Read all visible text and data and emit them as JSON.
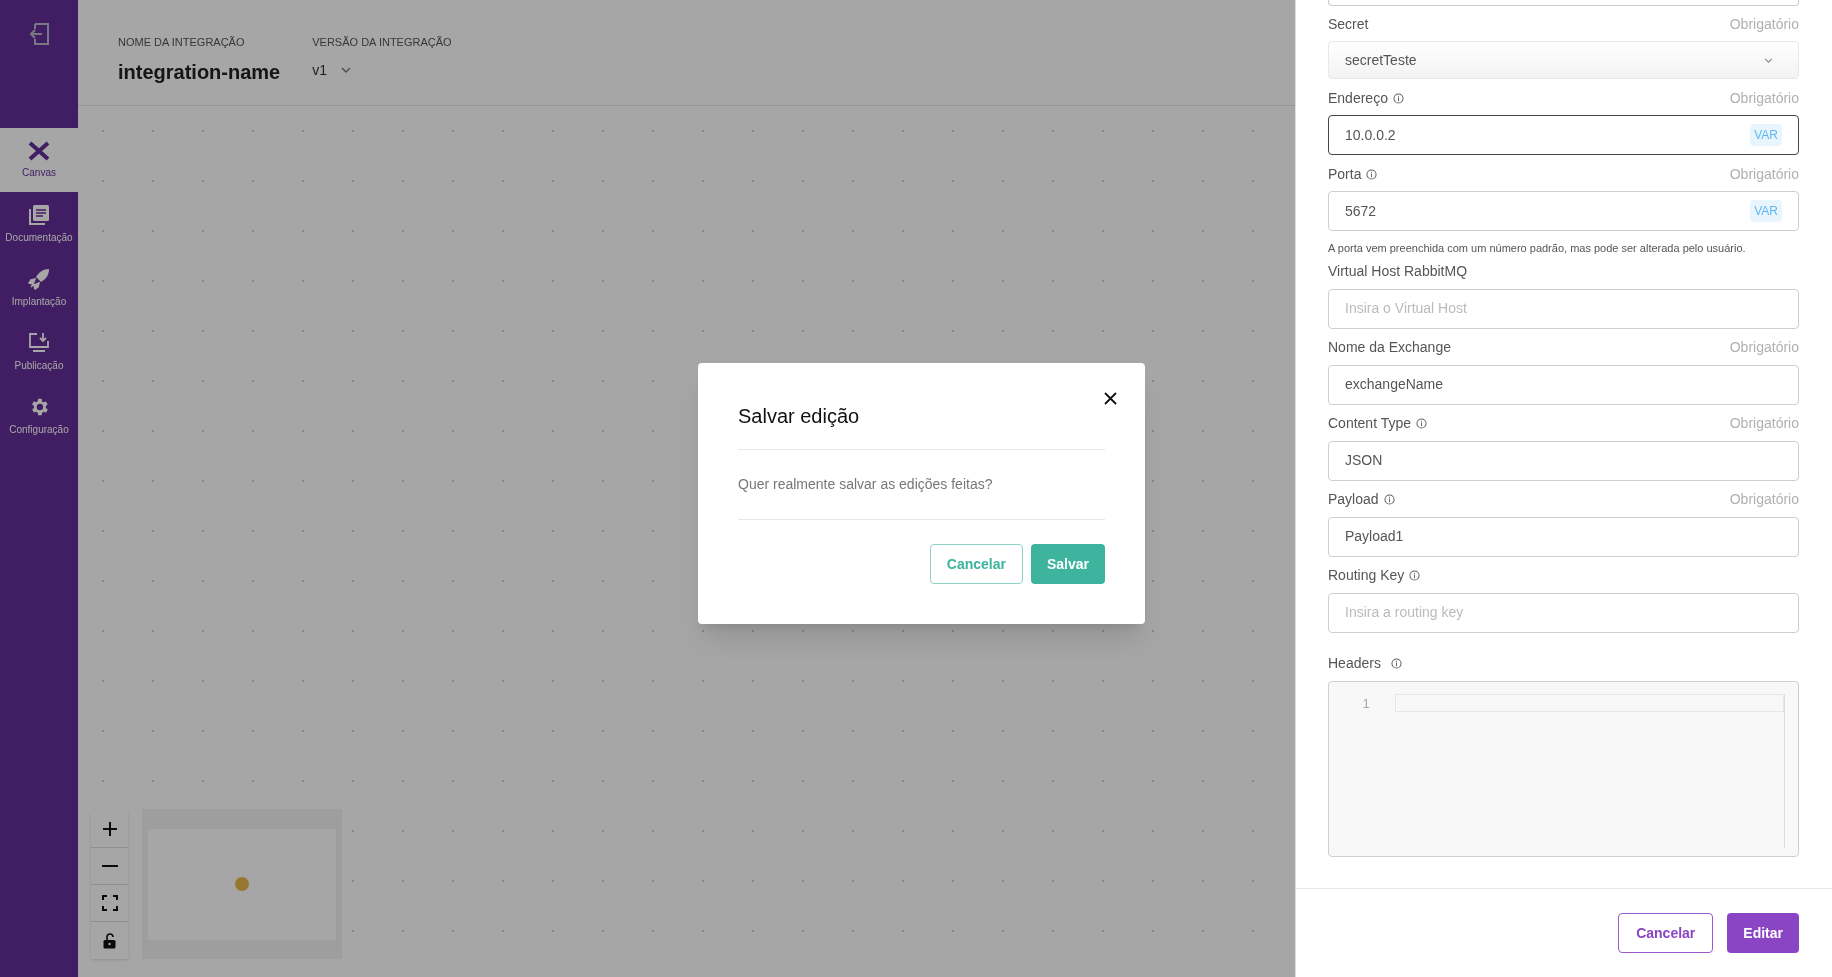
{
  "sidebar": {
    "items": [
      {
        "label": "Canvas",
        "selected": true
      },
      {
        "label": "Documentação",
        "selected": false
      },
      {
        "label": "Implantação",
        "selected": false
      },
      {
        "label": "Publicação",
        "selected": false
      },
      {
        "label": "Configuração",
        "selected": false
      }
    ]
  },
  "header": {
    "name_label": "NOME DA INTEGRAÇÃO",
    "name": "integration-name",
    "version_label": "VERSÃO DA INTEGRAÇÃO",
    "version": "v1"
  },
  "modal": {
    "title": "Salvar edição",
    "message": "Quer realmente salvar as edições feitas?",
    "buttons": [
      {
        "label": "Cancelar",
        "kind": "outline"
      },
      {
        "label": "Salvar",
        "kind": "primary"
      }
    ]
  },
  "panel": {
    "fields": [
      {
        "kind": "select",
        "label": "Secret",
        "info": false,
        "required": "Obrigatório",
        "value": "secretTeste"
      },
      {
        "kind": "input",
        "label": "Endereço",
        "info": true,
        "required": "Obrigatório",
        "value": "10.0.0.2",
        "badge": "VAR",
        "focused": true
      },
      {
        "kind": "input",
        "label": "Porta",
        "info": true,
        "required": "Obrigatório",
        "value": "5672",
        "badge": "VAR",
        "focused": false,
        "hint": "A porta vem preenchida com um número padrão, mas pode ser alterada pelo usuário."
      },
      {
        "kind": "input",
        "label": "Virtual Host RabbitMQ",
        "info": false,
        "placeholder": "Insira o Virtual Host",
        "focused": false
      },
      {
        "kind": "input",
        "label": "Nome da Exchange",
        "info": false,
        "required": "Obrigatório",
        "value": "exchangeName",
        "focused": false
      },
      {
        "kind": "input",
        "label": "Content Type",
        "info": true,
        "required": "Obrigatório",
        "value": "JSON",
        "focused": false
      },
      {
        "kind": "input",
        "label": "Payload",
        "info": true,
        "required": "Obrigatório",
        "value": "Payload1",
        "focused": false
      },
      {
        "kind": "input",
        "label": "Routing Key",
        "info": true,
        "placeholder": "Insira a routing key",
        "focused": false
      },
      {
        "kind": "code",
        "label": "Headers",
        "info": true,
        "line_numbers": [
          "1"
        ]
      }
    ],
    "buttons": [
      {
        "label": "Cancelar",
        "kind": "outline"
      },
      {
        "label": "Editar",
        "kind": "primary"
      }
    ]
  }
}
